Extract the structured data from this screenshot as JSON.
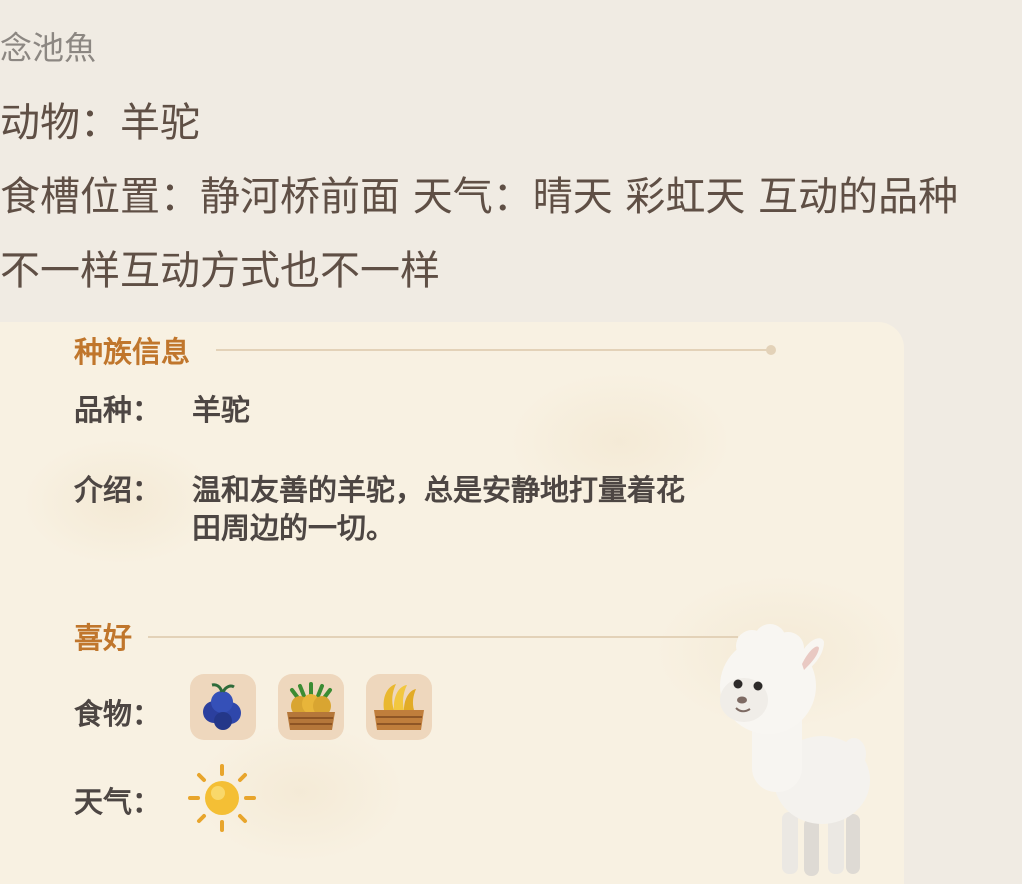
{
  "post": {
    "author": "念池魚",
    "animal_line": "动物：羊驼",
    "location_line": "食槽位置：静河桥前面 天气：晴天 彩虹天 互动的品种",
    "note_line": "不一样互动方式也不一样"
  },
  "card": {
    "species_section_title": "种族信息",
    "breed_label": "品种：",
    "breed_value": "羊驼",
    "intro_label": "介绍：",
    "intro_line1": "温和友善的羊驼，总是安静地打量着花",
    "intro_line2": "田周边的一切。",
    "likes_section_title": "喜好",
    "food_label": "食物：",
    "weather_label": "天气：",
    "foods": [
      {
        "icon": "blueberry-icon"
      },
      {
        "icon": "pineapple-crate-icon"
      },
      {
        "icon": "banana-crate-icon"
      }
    ],
    "weather_icon": "sun-icon"
  },
  "colors": {
    "page_background": "#f0ebe3",
    "post_text": "#5f4f45",
    "author_text": "#8c8782",
    "card_background": "#f8f1e2",
    "section_title": "#c0762c",
    "card_text": "#4d4643",
    "food_tile": "#eed7bd"
  }
}
